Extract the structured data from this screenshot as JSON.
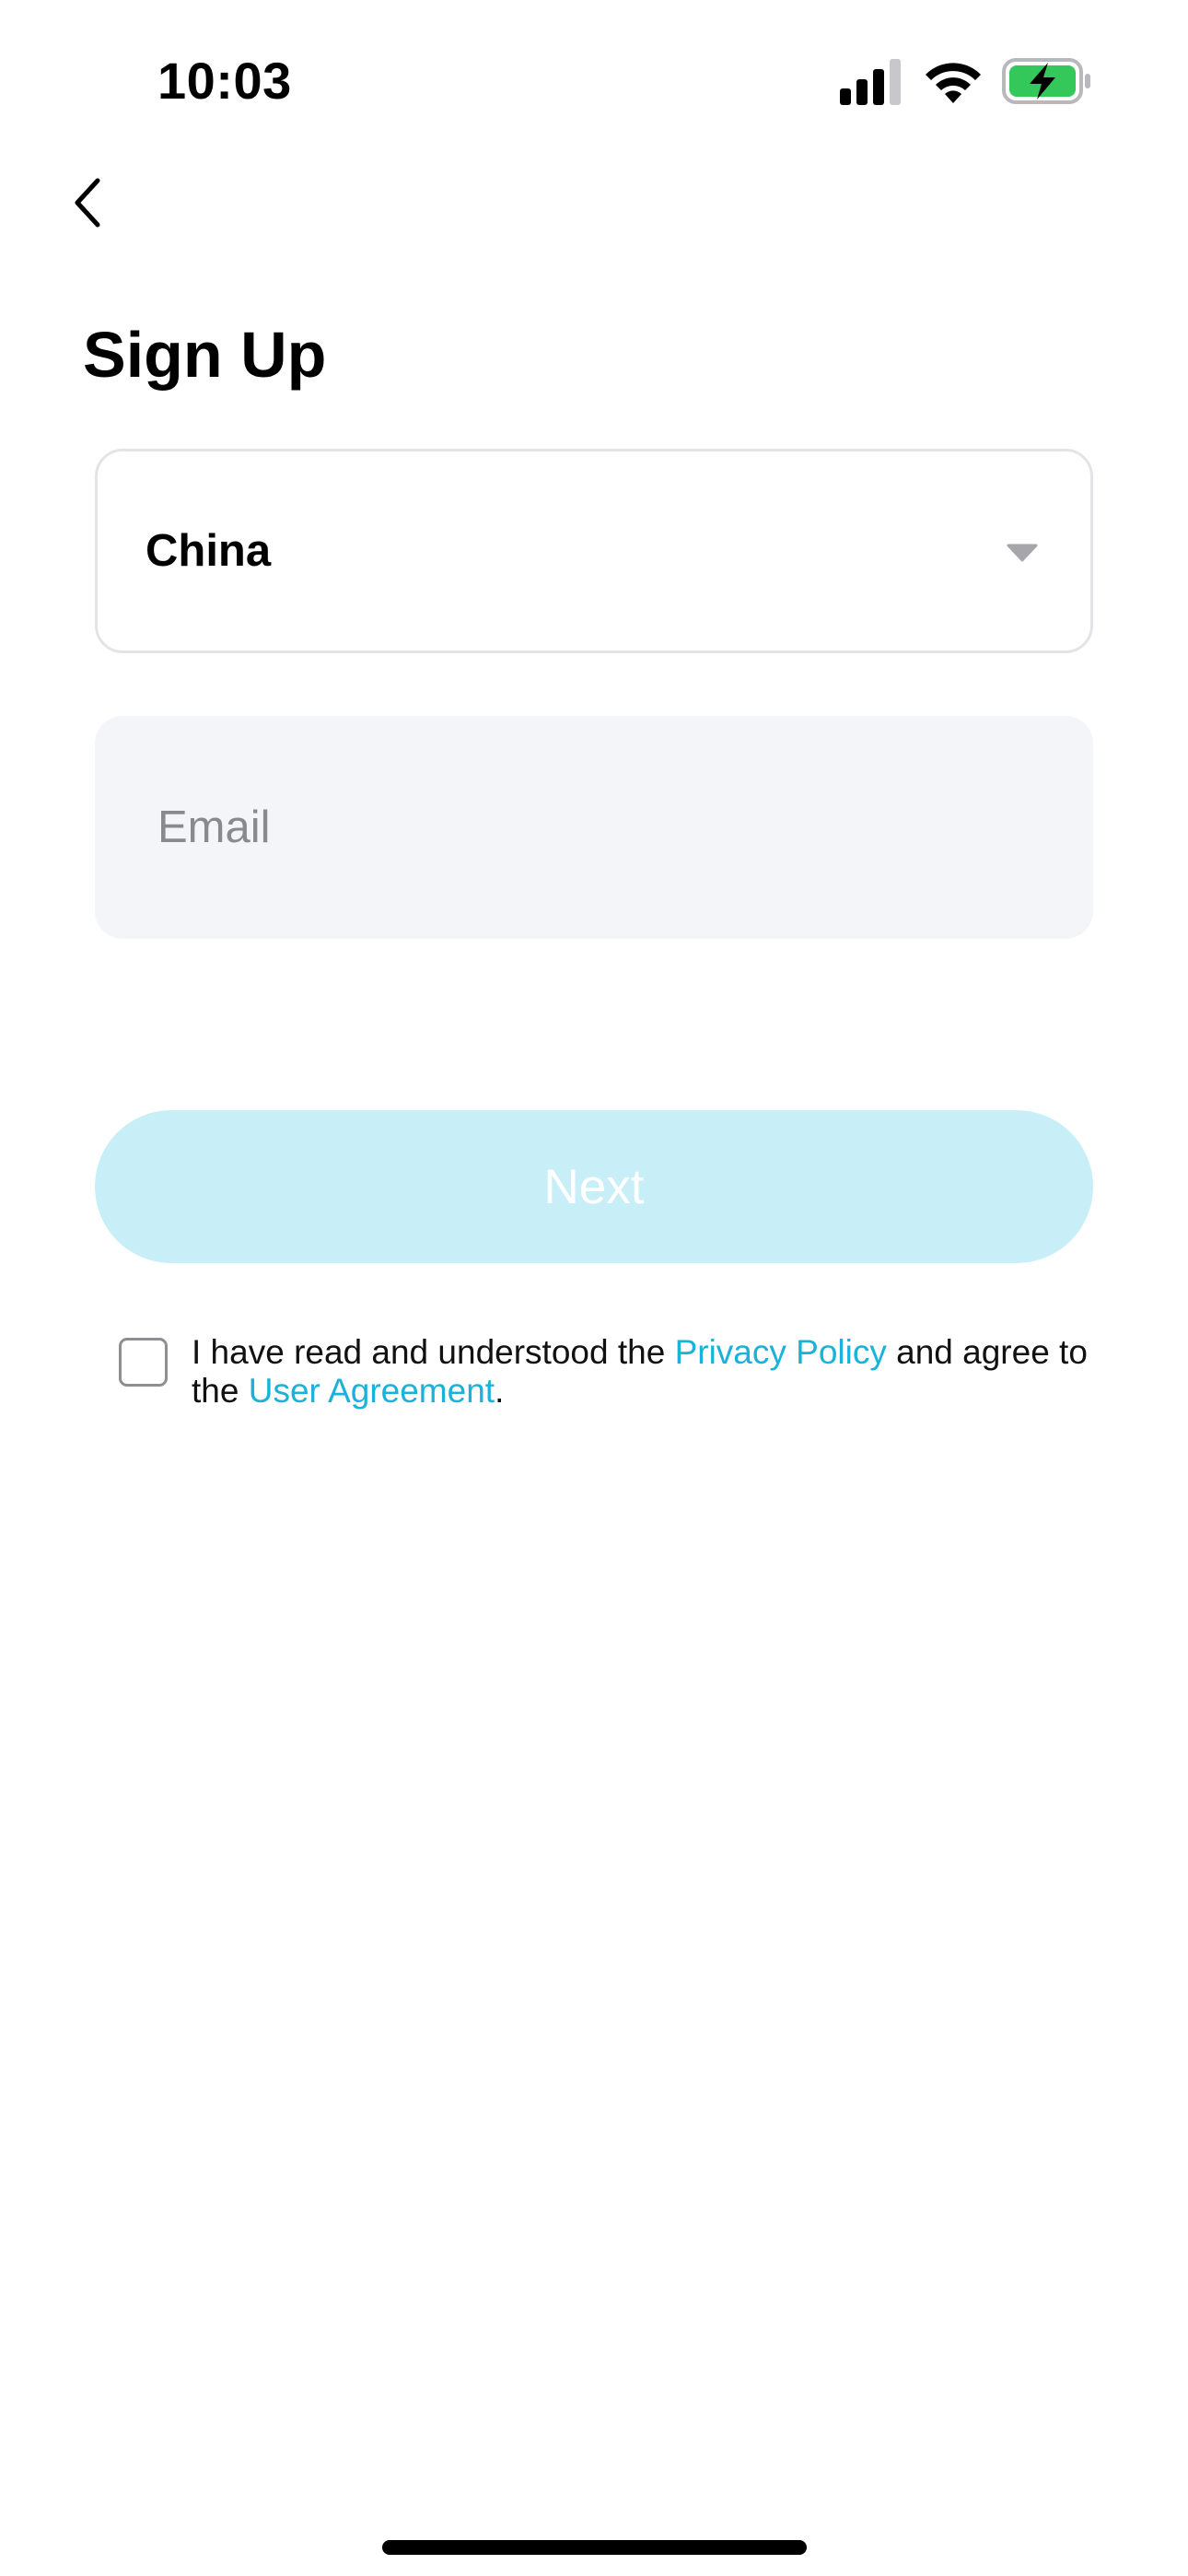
{
  "status_bar": {
    "time": "10:03",
    "icons": [
      "signal-icon",
      "wifi-icon",
      "battery-charging-icon"
    ],
    "battery_color": "#34c759"
  },
  "nav": {
    "back_icon": "chevron-left-icon"
  },
  "title": "Sign Up",
  "country": {
    "selected": "China",
    "icon": "caret-down-icon"
  },
  "email": {
    "value": "",
    "placeholder": "Email"
  },
  "next_button": {
    "label": "Next",
    "color": "#c8eef8"
  },
  "agreement": {
    "checked": false,
    "text_before": "I have read and understood the ",
    "privacy_link": "Privacy Policy",
    "text_middle": " and agree to the ",
    "user_link": "User Agreement",
    "text_after": ".",
    "link_color": "#1ab2d8"
  }
}
